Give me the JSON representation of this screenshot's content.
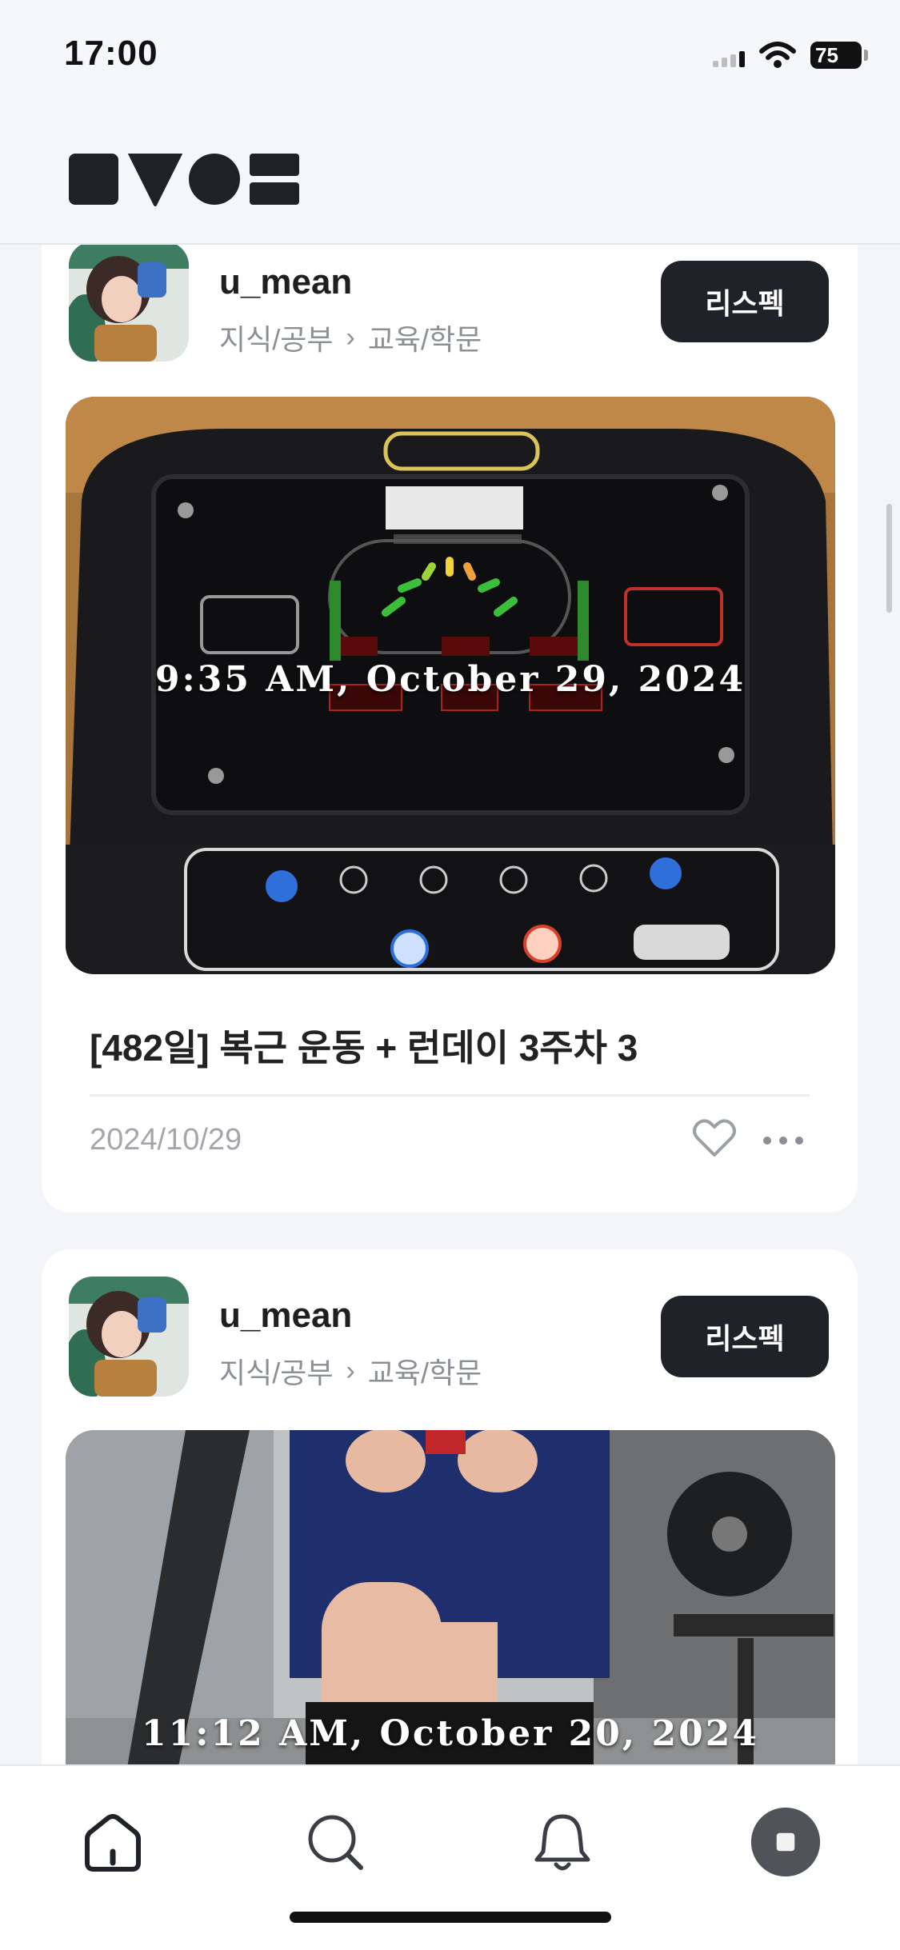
{
  "status_bar": {
    "time": "17:00",
    "battery": "75"
  },
  "header": {
    "logo_icon": "brand-logo-icon"
  },
  "posts": [
    {
      "author": "u_mean",
      "category": "지식/공부",
      "subcategory": "교육/학문",
      "follow_label": "리스펙",
      "photo_overlay": "9:35 AM, October 29, 2024",
      "title": "[482일] 복근 운동 + 런데이 3주차 3",
      "date": "2024/10/29"
    },
    {
      "author": "u_mean",
      "category": "지식/공부",
      "subcategory": "교육/학문",
      "follow_label": "리스펙",
      "photo_overlay": "11:12 AM, October 20, 2024"
    }
  ],
  "tab_bar": {
    "items": [
      {
        "icon": "home-icon",
        "active": true
      },
      {
        "icon": "search-icon",
        "active": false
      },
      {
        "icon": "bell-icon",
        "active": false
      },
      {
        "icon": "profile-icon",
        "active": false
      }
    ]
  },
  "colors": {
    "button_bg": "#1f2329",
    "muted_text": "#8b8f96",
    "background": "#f4f5f9"
  }
}
